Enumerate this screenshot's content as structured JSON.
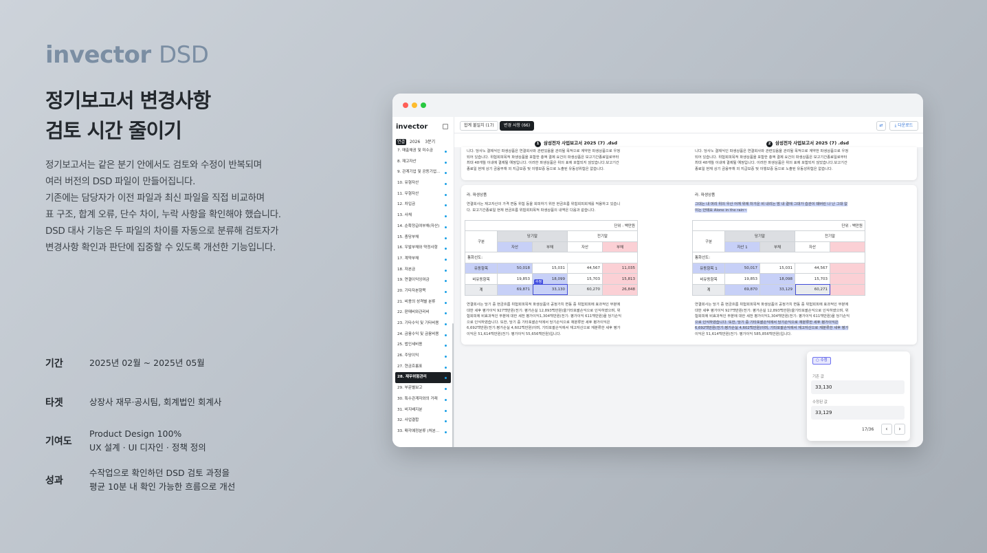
{
  "brand": {
    "name": "invector",
    "suffix": "DSD"
  },
  "headline": {
    "line1": "정기보고서 변경사항",
    "line2": "검토 시간 줄이기"
  },
  "description": [
    "정기보고서는 같은 분기 안에서도 검토와 수정이 반복되며",
    "여러 버전의 DSD 파일이 만들어집니다.",
    "기존에는 담당자가 이전 파일과 최신 파일을 직접 비교하며",
    "표 구조, 합계 오류, 단수 차이, 누락 사항을 확인해야 했습니다.",
    "DSD 대사 기능은 두 파일의 차이를 자동으로 분류해 검토자가",
    "변경사항 확인과 판단에 집중할 수 있도록 개선한 기능입니다."
  ],
  "meta": {
    "period": {
      "label": "기간",
      "value": "2025년 02월 ~ 2025년 05월"
    },
    "target": {
      "label": "타겟",
      "value": "상장사 재무·공시팀, 회계법인 회계사"
    },
    "contribution": {
      "label": "기여도",
      "value1": "Product Design 100%",
      "value2": " UX 설계 · UI 디자인 · 정책 정의"
    },
    "result": {
      "label": "성과",
      "value1": "수작업으로 확인하던 DSD 검토 과정을",
      "value2": "평균 10분 내 확인 가능한 흐름으로 개선"
    }
  },
  "app": {
    "logo": "invector",
    "filters": {
      "type": "연결",
      "year": "2026",
      "quarter": "3분기"
    },
    "sidebar_items": [
      {
        "label": "7. 매출채권 및 미수금",
        "dot": true
      },
      {
        "label": "8. 재고자산",
        "dot": true
      },
      {
        "label": "9. 관계기업 및 공동기업...",
        "dot": true
      },
      {
        "label": "10. 유형자산",
        "dot": true
      },
      {
        "label": "11. 무형자산",
        "dot": true
      },
      {
        "label": "12. 차입금",
        "dot": true
      },
      {
        "label": "13. 사채",
        "dot": true
      },
      {
        "label": "14. 순확정급여부채(자산)",
        "dot": true
      },
      {
        "label": "15. 충당부채",
        "dot": true
      },
      {
        "label": "16. 우발부채와 약정사항",
        "dot": true
      },
      {
        "label": "17. 계약부채",
        "dot": true
      },
      {
        "label": "18. 자본금",
        "dot": true
      },
      {
        "label": "19. 연결이익잉여금",
        "dot": true
      },
      {
        "label": "20. 기타자본항목",
        "dot": true
      },
      {
        "label": "21. 비용의 성격별 분류",
        "dot": true
      },
      {
        "label": "22. 판매비와관리비",
        "dot": true
      },
      {
        "label": "23. 기타수익 및 기타비용",
        "dot": true
      },
      {
        "label": "24. 금융수익 및 금융비용",
        "dot": true
      },
      {
        "label": "25. 법인세비용",
        "dot": true
      },
      {
        "label": "26. 주당이익",
        "dot": true
      },
      {
        "label": "27. 현금흐름표",
        "dot": true
      },
      {
        "label": "28. 재무위험관리",
        "dot": true,
        "active": true
      },
      {
        "label": "29. 부문별보고",
        "dot": true
      },
      {
        "label": "30. 특수관계자와의 거래",
        "dot": true
      },
      {
        "label": "31. 비지배지분",
        "dot": true
      },
      {
        "label": "32. 사업결합",
        "dot": true
      },
      {
        "label": "33. 매각예정분류 (처분...",
        "dot": true
      }
    ],
    "tabs": [
      {
        "label": "합계 불일치 (17)"
      },
      {
        "label": "변경 사항 (66)",
        "active": true
      }
    ],
    "download_label": "다운로드",
    "files": [
      {
        "num": "1",
        "name": "삼성전자 사업보고서 2025 (7) .dsd"
      },
      {
        "num": "2",
        "name": "삼성전자 사업보고서 2025 (7) .dsd"
      }
    ],
    "left": {
      "top_lines": [
        "니다. 당사노 결제식인 파생상품은 연결회사와 관련있음을 관리될 목적으로 계약한 파생상품으로 우정",
        "되어 있습니다. 위험회피목적 파생상품을 포함한 총액 결제 요건의 파생상품은 보고기간종료일로부터",
        "최대 48개월 이내에 결제될 예정입니다. 이러한 파생상품은 위의 표에 포함되지 않았습니다.보고기간",
        "종료일 현재 상기 금융부채 외 지급보증 및 이행보증 등으로 노출된 유동성위험은 없습니다."
      ],
      "section": "라. 파생상품",
      "intro_lines": [
        "연결회사는 재고자산의 가격 변동 위험 등을 회피하기 위한 현금흐름 위험회피회계를 적용하고 있습니",
        "다. 보고기간종료일 현재 현금흐름 위험회피목적 파생상품의 내역은 다음과 같습니다."
      ],
      "unit": "단위 : 백만원",
      "h_gubun": "구분",
      "h_cur": "당기말",
      "h_prev": "전기말",
      "h_asset1": "자산",
      "h_liab1": "부채",
      "h_asset2": "자산",
      "h_liab2": "부채",
      "currency": "통화선도:",
      "rows": [
        {
          "label": "유동항목",
          "v": [
            "50,018",
            "15,031",
            "44,567",
            "11,035"
          ]
        },
        {
          "label": "비유동항목",
          "v": [
            "19,853",
            "18,099",
            "15,703",
            "15,813"
          ]
        },
        {
          "label": "계",
          "v": [
            "69,871",
            "33,130",
            "60,270",
            "26,848"
          ]
        }
      ],
      "badge": "수정",
      "outro_lines": [
        "연결회사는 당기 중 현금흐름 위험회피목적 파생상품의 공정가치 변동 중 위험회피에 효과적인 부분에",
        "대한 세후 평가이익 927백만원(전기: 평가손실 12,893백만원)을기타포괄손익으로 인식하였으며, 위",
        "험회피에 비효과적인 부분에 대한 세전 평가이익1,304백만원(전기: 평가이익 611백만원)을 당기손익",
        "으로 인식하였습니다. 또한, 당기 중 기타포괄손익에서 당기손익으로 재분류한 세후 평가이익은",
        "6,692백만원(전기:평가손실 4,602백만원)이며, 기타포괄손익에서 재고자산으로 재분류한 세후 평가",
        "이익은 51,614백만원(전기: 평가이익 55,656백만원)입니다."
      ]
    },
    "right": {
      "top_lines": [
        "니다. 당사노 결제식인 파생상품은 연결회사와 관련있음을 관리될 목적으로 계약한 파생상품으로 우정",
        "되어 있습니다. 위험회피목적 파생상품을 포함한 총액 결제 요건의 파생상품은 보고기간종료일로부터",
        "최대 48개월 이내에 결제될 예정입니다. 이러한 파생상품은 위의 표에 포함되지 않았습니다.보고기간",
        "종료일 현재 상기 금융부채 외 지급보증 및 이행보증 등으로 노출된 유동성위험은 없습니다."
      ],
      "section": "라. 파생상품",
      "intro_lines": [
        "그대는 내 머리 위의 우산 어깨 위에 차가운 비 내리는 밤 내 곁에 그대가 습관이 돼버린 나 난 그대 없",
        "이는 안돼요 Alone in the rain~"
      ],
      "unit": "단위 : 백만원",
      "h_gubun": "구분",
      "h_cur": "당기말",
      "h_prev": "전기말",
      "h_asset1": "자산 1",
      "h_liab1": "부채",
      "h_asset2": "자산",
      "h_liab2": "",
      "currency": "통화선도:",
      "rows": [
        {
          "label": "유동항목 1",
          "v": [
            "50,017",
            "15,031",
            "44,567",
            ""
          ]
        },
        {
          "label": "비유동항목",
          "v": [
            "19,853",
            "18,098",
            "15,703",
            ""
          ]
        },
        {
          "label": "계",
          "v": [
            "69,870",
            "33,129",
            "60,271",
            ""
          ]
        }
      ],
      "outro_lines": [
        "연결회사는 당기 중 현금흐름 위험회피목적 파생상품의 공정가치 변동 중 위험회피에 효과적인 부분에",
        "대한 세후 평가이익 927백만원(전기: 평가손실 12,893백만원)을기타포괄손익으로 인식하였으며, 위",
        "험회피에 비효과적인 부분에 대한 세전 평가이익1,304백만원(전기: 평가이익 611백만원)을 당기손익",
        "으로 인식하였습니다. 또한, 당기 중 기타포괄손익에서 당기손익으로 재분류한 세후 평가이익은",
        "6,692백만원(전기:평가손실 4,602백만원)이며, 기타포괄손익에서 재고자산으로 재분류한 세후 평가",
        "이익은 51,614백만원(전기: 평가이익 585,856백만원)입니다."
      ]
    },
    "panel": {
      "chip": "수정",
      "before_label": "기존 값",
      "before_value": "33,130",
      "after_label": "수정된 값",
      "after_value": "33,129",
      "count": "17/36"
    }
  },
  "colors": {
    "accent": "#4450e0",
    "added": "#c7d0f7",
    "removed": "#fbd0d5",
    "dot": "#1aa0e6"
  }
}
